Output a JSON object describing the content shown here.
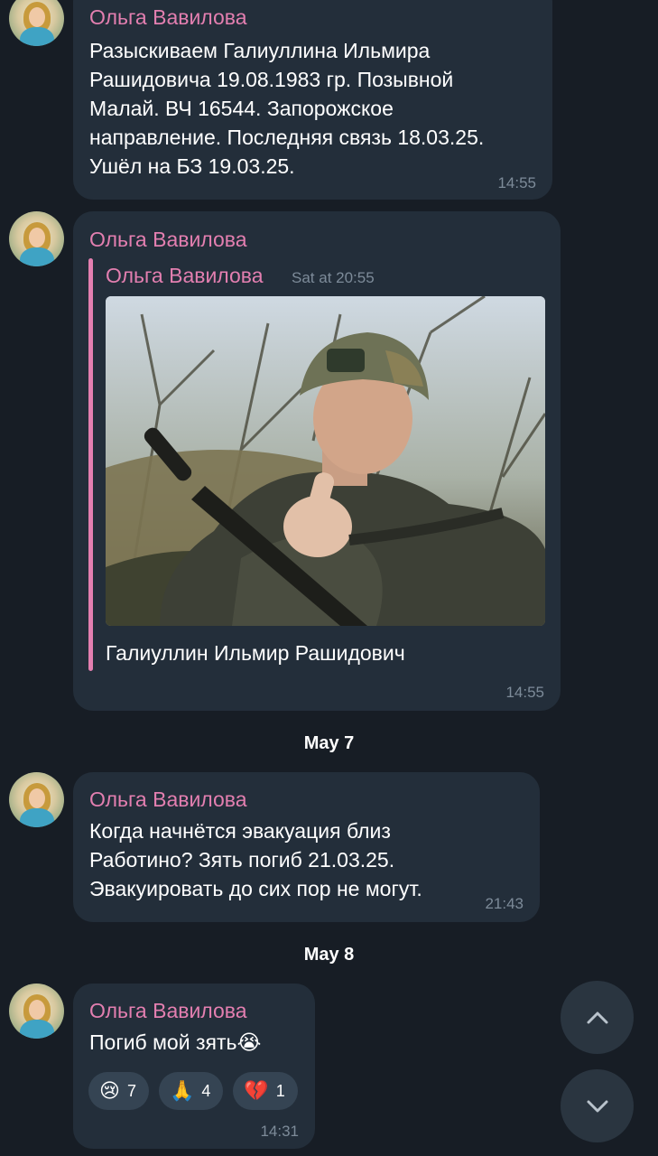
{
  "messages": [
    {
      "sender": "Ольга Вавилова",
      "lines": [
        "Разыскиваем Галиуллина Ильмира",
        "Рашидовича 19.08.1983 гр. Позывной",
        "Малай. ВЧ 16544. Запорожское",
        "направление. Последняя связь 18.03.25.",
        "Ушёл на БЗ 19.03.25."
      ],
      "time": "14:55"
    },
    {
      "sender": "Ольга Вавилова",
      "reply_sender": "Ольга Вавилова",
      "reply_date": "Sat at 20:55",
      "caption": "Галиуллин Ильмир Рашидович",
      "time": "14:55"
    },
    {
      "sender": "Ольга Вавилова",
      "lines": [
        "Когда начнётся эвакуация близ",
        "Работино? Зять погиб 21.03.25.",
        "Эвакуировать до сих пор не могут."
      ],
      "time": "21:43"
    },
    {
      "sender": "Ольга Вавилова",
      "text": "Погиб мой зять",
      "text_emoji": "😭",
      "reactions": [
        {
          "emoji": "😢",
          "count": "7"
        },
        {
          "emoji": "🙏",
          "count": "4"
        },
        {
          "emoji": "💔",
          "count": "1"
        }
      ],
      "time": "14:31"
    }
  ],
  "dates": [
    "May 7",
    "May 8"
  ],
  "icons": {
    "scroll_up": "chevron-up-icon",
    "scroll_down": "chevron-down-icon"
  },
  "colors": {
    "background": "#171d25",
    "bubble": "#232e3a",
    "sender": "#e37fb0",
    "time": "#7d8b99"
  }
}
